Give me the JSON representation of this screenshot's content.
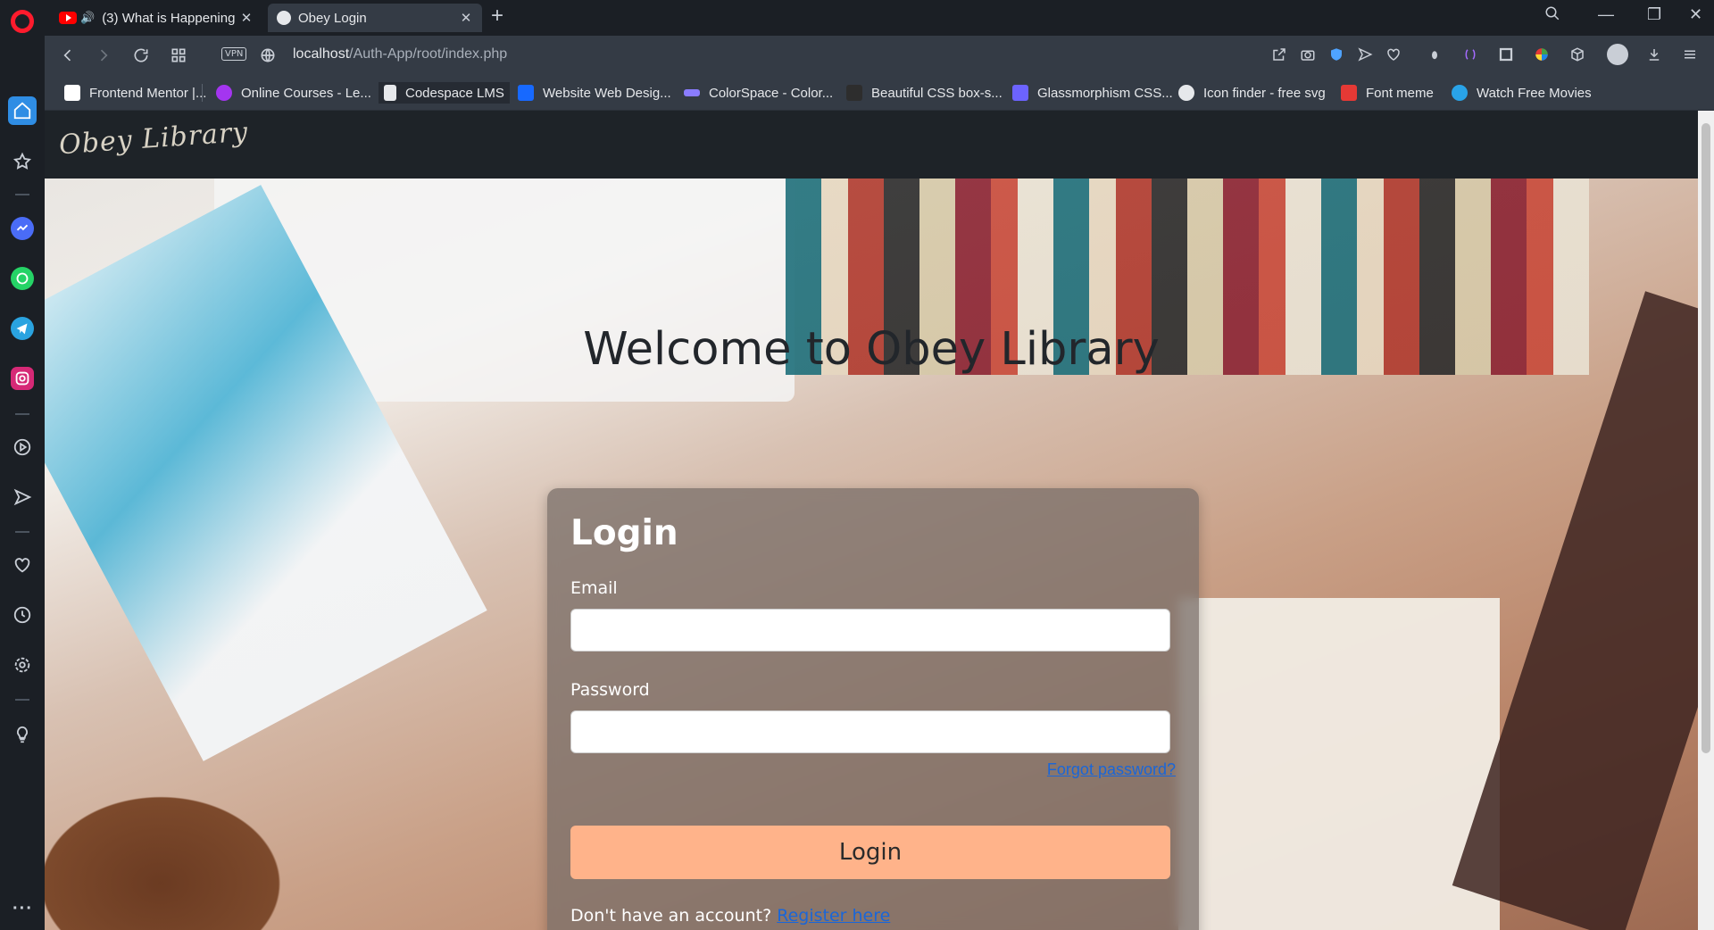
{
  "browser": {
    "tabs": [
      {
        "title": "(3) What is Happening",
        "icon": "youtube-icon",
        "audio": true
      },
      {
        "title": "Obey Login",
        "icon": "globe-icon",
        "active": true
      }
    ],
    "url_host": "localhost",
    "url_path": "/Auth-App/root/index.php",
    "vpn_label": "VPN",
    "bookmarks": [
      {
        "label": "Frontend Mentor |...",
        "color": "#ffffff"
      },
      {
        "label": "Online Courses - Le...",
        "color": "#a435f0"
      },
      {
        "label": "Codespace LMS",
        "color": "#e6e8eb"
      },
      {
        "label": "Website Web Desig...",
        "color": "#1769ff"
      },
      {
        "label": "ColorSpace - Color...",
        "color": "#8a7cff"
      },
      {
        "label": "Beautiful CSS box-s...",
        "color": "#2d2d2d"
      },
      {
        "label": "Glassmorphism CSS...",
        "color": "#6c63ff"
      },
      {
        "label": "Icon finder - free svg",
        "color": "#e6e8eb"
      },
      {
        "label": "Font meme",
        "color": "#e53935"
      },
      {
        "label": "Watch Free Movies",
        "color": "#29a3e8"
      }
    ]
  },
  "site": {
    "logo": "Obey Library",
    "welcome": "Welcome to Obey Library"
  },
  "login": {
    "title": "Login",
    "email_label": "Email",
    "password_label": "Password",
    "forgot": "Forgot password?",
    "button": "Login",
    "register_prompt": "Don't have an account?",
    "register_link": "Register here"
  },
  "colors": {
    "accent_button": "#ffb38a",
    "link": "#1a66d8",
    "home_active": "#2f8de4"
  }
}
